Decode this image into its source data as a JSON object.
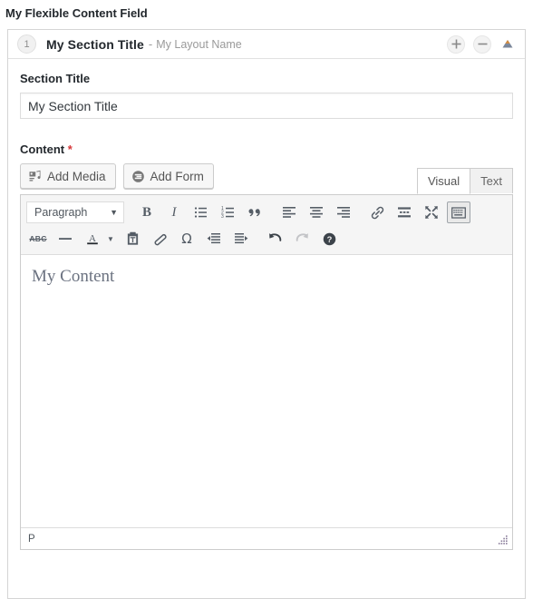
{
  "field": {
    "label": "My Flexible Content Field"
  },
  "layout": {
    "order": "1",
    "title": "My Section Title",
    "separator": "-",
    "name": "My Layout Name",
    "actions": {
      "add_label": "+",
      "remove_label": "−",
      "collapse_name": "collapse-toggle"
    }
  },
  "section_title_field": {
    "label": "Section Title",
    "value": "My Section Title",
    "placeholder": ""
  },
  "content_field": {
    "label": "Content",
    "required_mark": "*",
    "media_buttons": [
      {
        "label": "Add Media",
        "icon": "media-icon"
      },
      {
        "label": "Add Form",
        "icon": "form-icon"
      }
    ],
    "tabs": [
      {
        "label": "Visual",
        "active": true
      },
      {
        "label": "Text",
        "active": false
      }
    ],
    "toolbar_row1": {
      "format_select": {
        "value": "Paragraph",
        "caret": "▼"
      },
      "buttons": [
        {
          "name": "bold-icon",
          "label": "B"
        },
        {
          "name": "italic-icon",
          "label": "I"
        },
        {
          "name": "bulleted-list-icon",
          "label": "Bulleted list"
        },
        {
          "name": "numbered-list-icon",
          "label": "Numbered list"
        },
        {
          "name": "blockquote-icon",
          "label": "Blockquote"
        },
        {
          "name": "align-left-icon",
          "label": "Align left"
        },
        {
          "name": "align-center-icon",
          "label": "Align center"
        },
        {
          "name": "align-right-icon",
          "label": "Align right"
        },
        {
          "name": "link-icon",
          "label": "Insert link"
        },
        {
          "name": "read-more-icon",
          "label": "Insert Read More tag"
        },
        {
          "name": "fullscreen-icon",
          "label": "Distraction-free writing mode"
        },
        {
          "name": "toolbar-toggle-icon",
          "label": "Toolbar Toggle",
          "active": true
        }
      ]
    },
    "toolbar_row2": {
      "buttons": [
        {
          "name": "strikethrough-icon",
          "label": "ABC"
        },
        {
          "name": "horizontal-rule-icon",
          "label": "Horizontal line"
        },
        {
          "name": "text-color-icon",
          "label": "Text color",
          "caret": "▼"
        },
        {
          "name": "paste-as-text-icon",
          "label": "Paste as text"
        },
        {
          "name": "clear-formatting-icon",
          "label": "Clear formatting"
        },
        {
          "name": "special-character-icon",
          "label": "Ω"
        },
        {
          "name": "outdent-icon",
          "label": "Decrease indent"
        },
        {
          "name": "indent-icon",
          "label": "Increase indent"
        },
        {
          "name": "undo-icon",
          "label": "Undo"
        },
        {
          "name": "redo-icon",
          "label": "Redo",
          "disabled": true
        },
        {
          "name": "help-icon",
          "label": "Keyboard Shortcuts"
        }
      ]
    },
    "editor_body": "My Content",
    "statusbar": {
      "path": "P"
    }
  },
  "colors": {
    "required": "#d63638",
    "border": "#cccccc",
    "toolbar_bg": "#f5f5f5",
    "icon": "#555d66"
  }
}
